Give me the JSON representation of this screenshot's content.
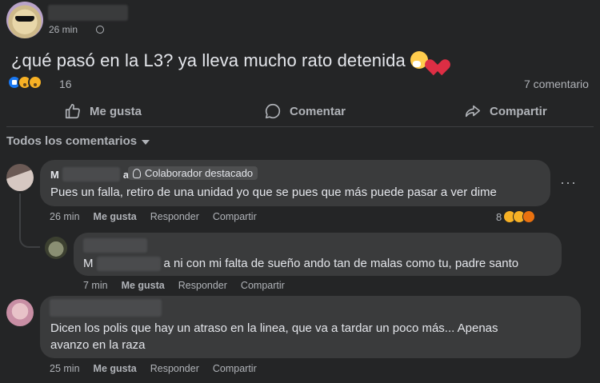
{
  "post": {
    "time": "26 min",
    "text": "¿qué pasó en la L3? ya lleva mucho rato detenida",
    "reaction_count": "16",
    "comment_count": "7 comentario"
  },
  "actions": {
    "like": "Me gusta",
    "comment": "Comentar",
    "share": "Compartir"
  },
  "sort_label": "Todos los comentarios",
  "comments": [
    {
      "name_initial": "M",
      "name_suffix": "a",
      "badge": "Colaborador destacado",
      "text": "Pues un falla, retiro de una unidad yo que se pues que más puede pasar a ver dime",
      "time": "26 min",
      "like": "Me gusta",
      "reply": "Responder",
      "share": "Compartir",
      "reaction_count": "8"
    },
    {
      "name_initial": "M",
      "text": "a ni con mi falta de sueño ando tan de malas como tu, padre santo",
      "time": "7 min",
      "like": "Me gusta",
      "reply": "Responder",
      "share": "Compartir"
    },
    {
      "text": "Dicen los polis que hay un atraso en la linea, que va a tardar un poco más... Apenas avanzo en la raza",
      "time": "25 min",
      "like": "Me gusta",
      "reply": "Responder",
      "share": "Compartir"
    }
  ],
  "icons": {
    "like": "thumbs-up-icon",
    "comment": "speech-bubble-icon",
    "share": "share-arrow-icon",
    "globe": "globe-icon",
    "more": "more-dots-icon"
  }
}
